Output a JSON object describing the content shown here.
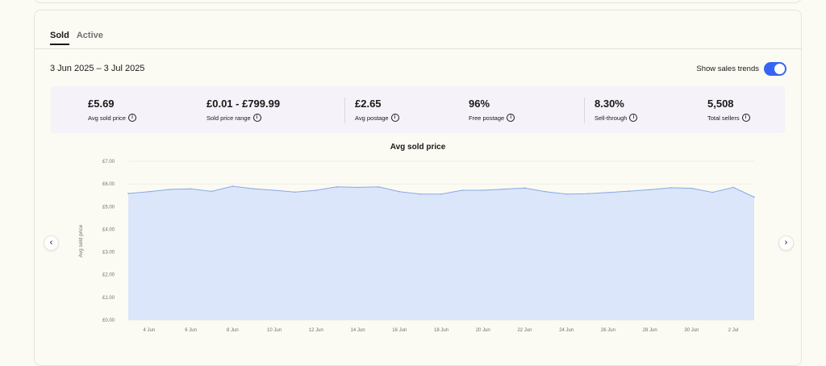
{
  "tabs": [
    {
      "label": "Sold",
      "active": true
    },
    {
      "label": "Active",
      "active": false
    }
  ],
  "date_range": "3 Jun 2025 – 3 Jul 2025",
  "sales_trends": {
    "label": "Show sales trends",
    "enabled": true
  },
  "stats": [
    {
      "value": "£5.69",
      "label": "Avg sold price"
    },
    {
      "value": "£0.01 - £799.99",
      "label": "Sold price range"
    },
    {
      "value": "£2.65",
      "label": "Avg postage"
    },
    {
      "value": "96%",
      "label": "Free postage"
    },
    {
      "value": "8.30%",
      "label": "Sell-through"
    },
    {
      "value": "5,508",
      "label": "Total sellers"
    }
  ],
  "icons": {
    "info": "info-icon",
    "prev": "chevron-left-icon",
    "next": "chevron-right-icon"
  },
  "nav": {
    "prev": "‹",
    "next": "›"
  },
  "chart_data": {
    "type": "area",
    "title": "Avg sold price",
    "ylabel": "Avg sold price",
    "xlabel": "",
    "ylim": [
      0,
      7
    ],
    "y_ticks": [
      "£0.00",
      "£1.00",
      "£2.00",
      "£3.00",
      "£4.00",
      "£5.00",
      "£6.00",
      "£7.00"
    ],
    "x_ticks": [
      {
        "day": 4,
        "label": "4 Jun"
      },
      {
        "day": 6,
        "label": "6 Jun"
      },
      {
        "day": 8,
        "label": "8 Jun"
      },
      {
        "day": 10,
        "label": "10 Jun"
      },
      {
        "day": 12,
        "label": "12 Jun"
      },
      {
        "day": 14,
        "label": "14 Jun"
      },
      {
        "day": 16,
        "label": "16 Jun"
      },
      {
        "day": 18,
        "label": "18 Jun"
      },
      {
        "day": 20,
        "label": "20 Jun"
      },
      {
        "day": 22,
        "label": "22 Jun"
      },
      {
        "day": 24,
        "label": "24 Jun"
      },
      {
        "day": 26,
        "label": "26 Jun"
      },
      {
        "day": 28,
        "label": "28 Jun"
      },
      {
        "day": 30,
        "label": "30 Jun"
      },
      {
        "day": 32,
        "label": "2 Jul"
      }
    ],
    "x_range": [
      3,
      33
    ],
    "x": [
      "3 Jun",
      "4 Jun",
      "5 Jun",
      "6 Jun",
      "7 Jun",
      "8 Jun",
      "9 Jun",
      "10 Jun",
      "11 Jun",
      "12 Jun",
      "13 Jun",
      "14 Jun",
      "15 Jun",
      "16 Jun",
      "17 Jun",
      "18 Jun",
      "19 Jun",
      "20 Jun",
      "21 Jun",
      "22 Jun",
      "23 Jun",
      "24 Jun",
      "25 Jun",
      "26 Jun",
      "27 Jun",
      "28 Jun",
      "29 Jun",
      "30 Jun",
      "1 Jul",
      "2 Jul",
      "3 Jul"
    ],
    "values": [
      5.58,
      5.66,
      5.76,
      5.78,
      5.67,
      5.9,
      5.79,
      5.72,
      5.64,
      5.72,
      5.87,
      5.85,
      5.87,
      5.66,
      5.55,
      5.55,
      5.72,
      5.72,
      5.77,
      5.82,
      5.66,
      5.55,
      5.57,
      5.62,
      5.68,
      5.75,
      5.83,
      5.81,
      5.63,
      5.85,
      5.42
    ],
    "colors": {
      "fill": "#dbe6fb",
      "line": "#8aa9e3",
      "grid": "#ecece4",
      "tick": "#707070"
    },
    "grid": true
  }
}
